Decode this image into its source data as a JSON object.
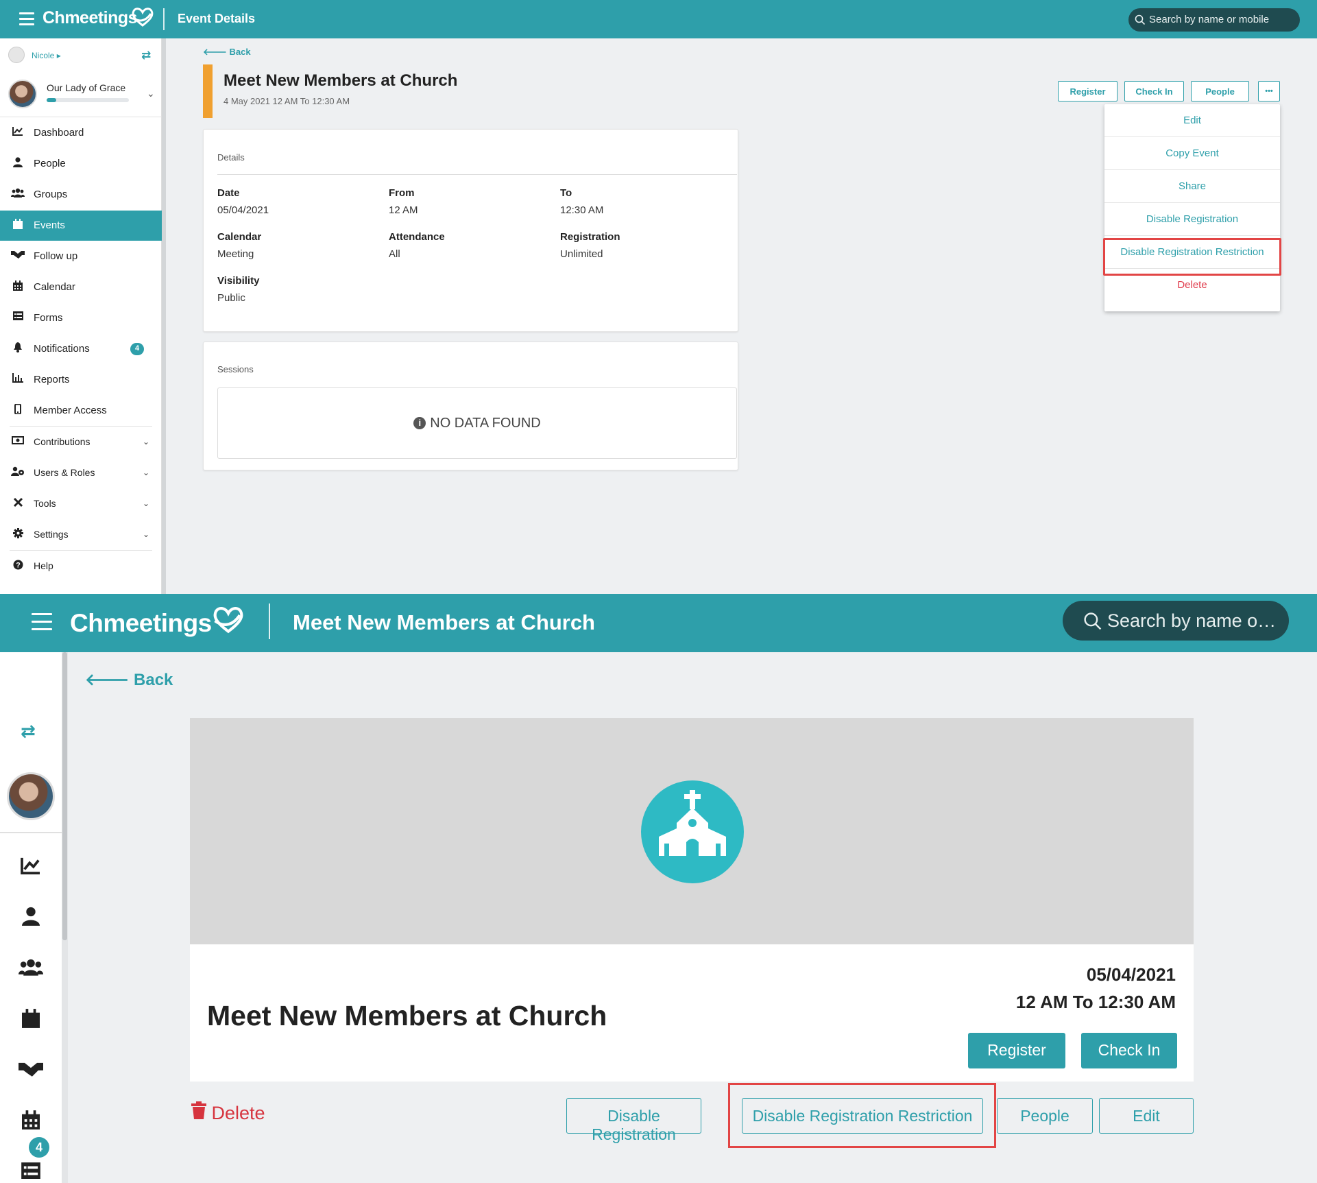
{
  "brand": {
    "name": "Chmeetings",
    "accent": "#2e9faa",
    "highlight": "#e24545",
    "danger": "#e03a4a"
  },
  "desktop": {
    "header": {
      "title": "Event Details",
      "search_placeholder": "Search by name or mobile"
    },
    "user": {
      "name": "Nicole",
      "church": "Our Lady of Grace"
    },
    "nav": {
      "dashboard": "Dashboard",
      "people": "People",
      "groups": "Groups",
      "events": "Events",
      "followup": "Follow up",
      "calendar": "Calendar",
      "forms": "Forms",
      "notifications": "Notifications",
      "notifications_count": "4",
      "reports": "Reports",
      "member_access": "Member Access",
      "contributions": "Contributions",
      "users_roles": "Users & Roles",
      "tools": "Tools",
      "settings": "Settings",
      "help": "Help"
    },
    "back": "Back",
    "event": {
      "title": "Meet New Members at Church",
      "subtitle": "4 May 2021 12 AM To 12:30 AM"
    },
    "actions": {
      "register": "Register",
      "checkin": "Check In",
      "people": "People",
      "more": "•••"
    },
    "menu": {
      "edit": "Edit",
      "copy": "Copy Event",
      "share": "Share",
      "disable_registration": "Disable Registration",
      "disable_restriction": "Disable Registration Restriction",
      "delete": "Delete"
    },
    "details": {
      "heading": "Details",
      "date_label": "Date",
      "date_value": "05/04/2021",
      "from_label": "From",
      "from_value": "12 AM",
      "to_label": "To",
      "to_value": "12:30 AM",
      "calendar_label": "Calendar",
      "calendar_value": "Meeting",
      "attendance_label": "Attendance",
      "attendance_value": "All",
      "registration_label": "Registration",
      "registration_value": "Unlimited",
      "visibility_label": "Visibility",
      "visibility_value": "Public"
    },
    "sessions": {
      "heading": "Sessions",
      "empty": "NO DATA FOUND"
    }
  },
  "tablet": {
    "header": {
      "title": "Meet New Members at Church",
      "search_placeholder": "Search by name o…"
    },
    "back": "Back",
    "notifications_count": "4",
    "event": {
      "title": "Meet New Members at Church",
      "date": "05/04/2021",
      "time": "12 AM To 12:30 AM"
    },
    "actions": {
      "register": "Register",
      "checkin": "Check In",
      "delete": "Delete",
      "disable_registration": "Disable Registration",
      "disable_restriction": "Disable Registration Restriction",
      "people": "People",
      "edit": "Edit"
    }
  }
}
